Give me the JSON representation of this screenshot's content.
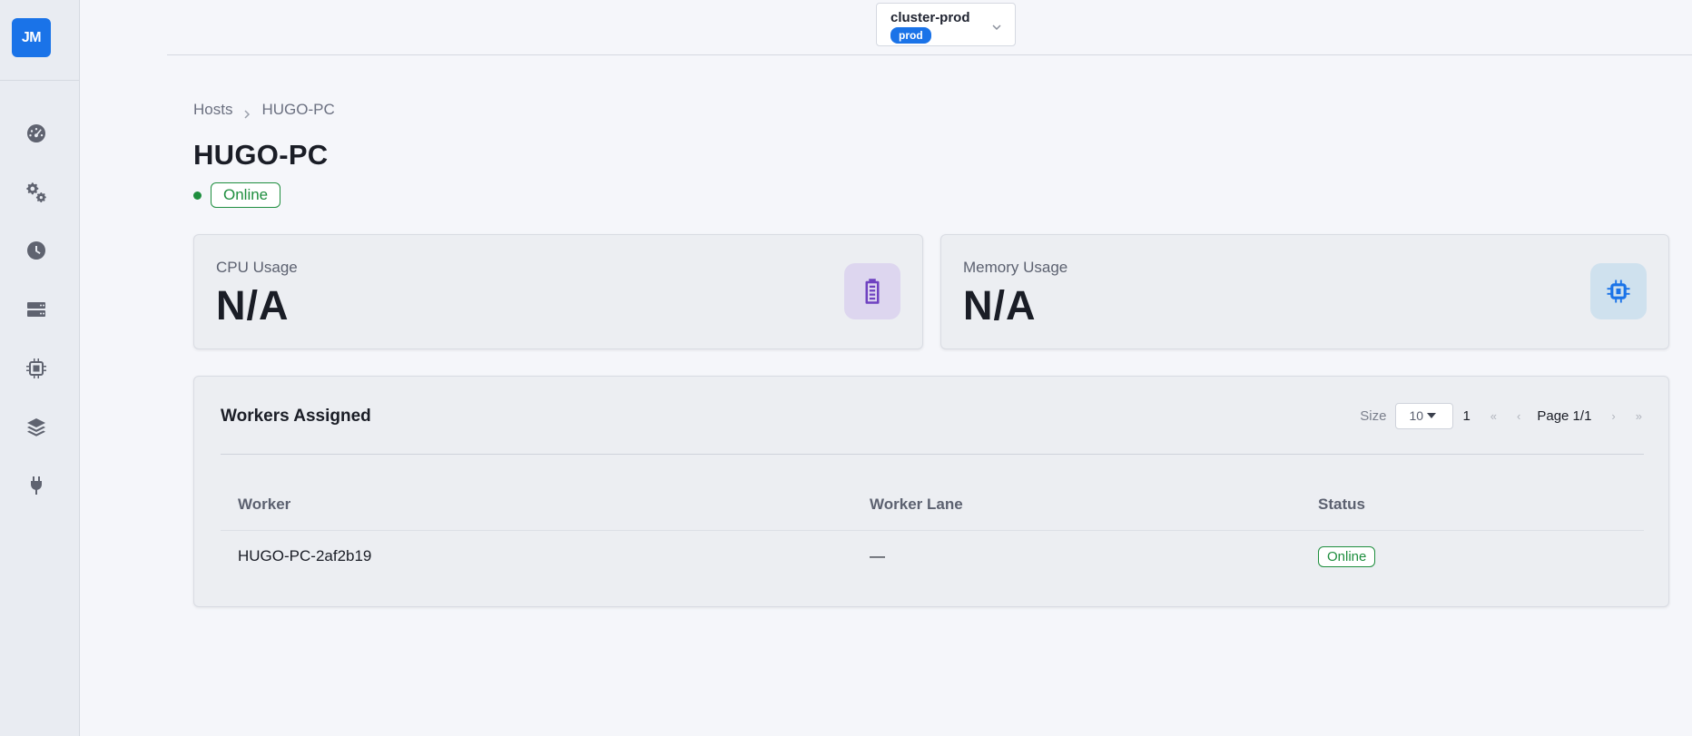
{
  "app": {
    "logo_text": "JM",
    "accent_color": "#1a73e8",
    "success_color": "#1e8e3e"
  },
  "sidebar": {
    "items": [
      {
        "icon": "dashboard-gauge-icon"
      },
      {
        "icon": "settings-gears-icon"
      },
      {
        "icon": "clock-history-icon"
      },
      {
        "icon": "server-icon"
      },
      {
        "icon": "cpu-chip-icon"
      },
      {
        "icon": "layers-icon"
      },
      {
        "icon": "plug-icon"
      }
    ]
  },
  "cluster": {
    "name": "cluster-prod",
    "env_badge": "prod"
  },
  "breadcrumb": {
    "parent": "Hosts",
    "current": "HUGO-PC"
  },
  "host": {
    "title": "HUGO-PC",
    "status": "Online"
  },
  "metrics": {
    "cpu": {
      "label": "CPU Usage",
      "value": "N/A",
      "icon": "memory-module-icon",
      "icon_color": "#6f42c1"
    },
    "memory": {
      "label": "Memory Usage",
      "value": "N/A",
      "icon": "cpu-chip-icon",
      "icon_color": "#1a73e8"
    }
  },
  "workers": {
    "title": "Workers Assigned",
    "pager": {
      "size_label": "Size",
      "size_value": "10",
      "current_page": "1",
      "first": "«",
      "prev": "‹",
      "page_info": "Page 1/1",
      "next": "›",
      "last": "»"
    },
    "columns": [
      "Worker",
      "Worker Lane",
      "Status"
    ],
    "rows": [
      {
        "worker": "HUGO-PC-2af2b19",
        "lane": "—",
        "status": "Online"
      }
    ]
  }
}
